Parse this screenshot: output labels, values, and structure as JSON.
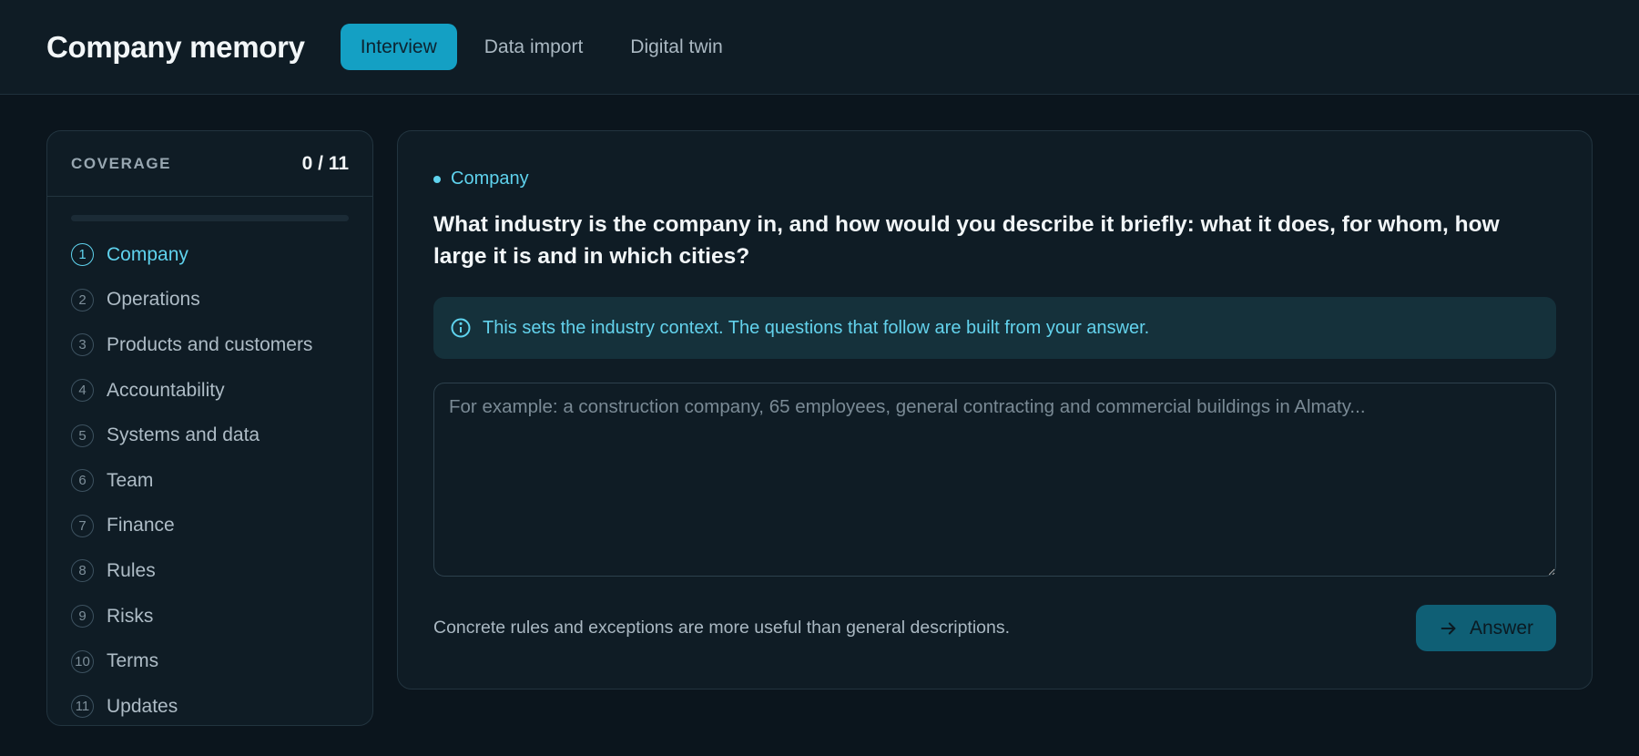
{
  "app": {
    "title": "Company memory"
  },
  "tabs": [
    {
      "label": "Interview",
      "active": true
    },
    {
      "label": "Data import",
      "active": false
    },
    {
      "label": "Digital twin",
      "active": false
    }
  ],
  "coverage": {
    "label": "COVERAGE",
    "count": "0 / 11",
    "progress_fraction": 0,
    "sections": [
      {
        "num": "1",
        "label": "Company",
        "active": true
      },
      {
        "num": "2",
        "label": "Operations"
      },
      {
        "num": "3",
        "label": "Products and customers"
      },
      {
        "num": "4",
        "label": "Accountability"
      },
      {
        "num": "5",
        "label": "Systems and data"
      },
      {
        "num": "6",
        "label": "Team"
      },
      {
        "num": "7",
        "label": "Finance"
      },
      {
        "num": "8",
        "label": "Rules"
      },
      {
        "num": "9",
        "label": "Risks"
      },
      {
        "num": "10",
        "label": "Terms"
      },
      {
        "num": "11",
        "label": "Updates"
      }
    ]
  },
  "question": {
    "section_tag": "Company",
    "text": "What industry is the company in, and how would you describe it briefly: what it does, for whom, how large it is and in which cities?",
    "hint": "This sets the industry context. The questions that follow are built from your answer.",
    "answer_value": "",
    "answer_placeholder": "For example: a construction company, 65 employees, general contracting and commercial buildings in Almaty...",
    "tip": "Concrete rules and exceptions are more useful than general descriptions.",
    "submit_label": "Answer"
  },
  "icons": {
    "info": "info-icon",
    "submit": "arrow-right-icon"
  },
  "colors": {
    "accent": "#14a0c4",
    "accent_text": "#5fd3ee",
    "background": "#0b151d",
    "panel": "#0f1c25"
  }
}
